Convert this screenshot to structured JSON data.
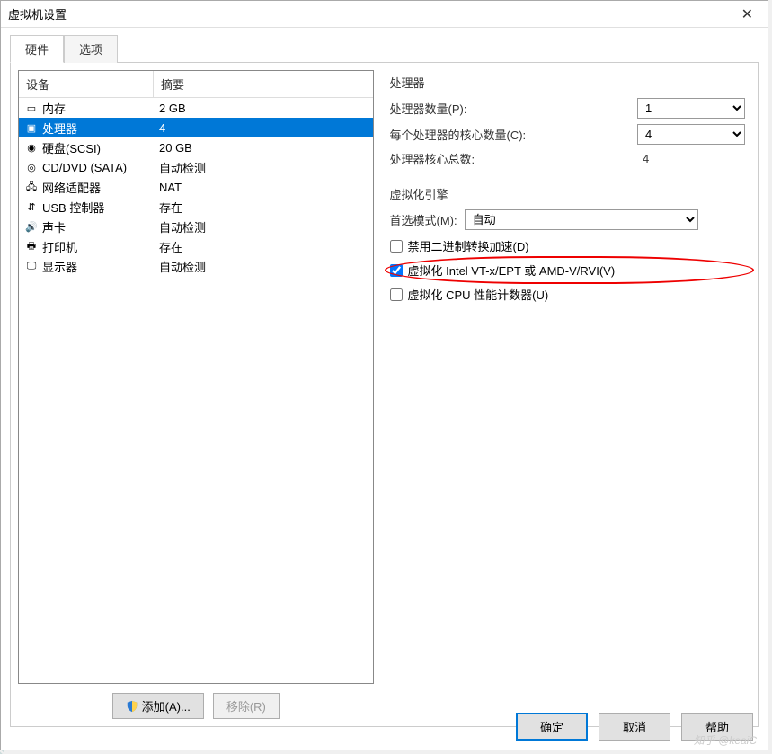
{
  "window": {
    "title": "虚拟机设置"
  },
  "tabs": {
    "hardware": "硬件",
    "options": "选项"
  },
  "hwlist": {
    "header_device": "设备",
    "header_summary": "摘要",
    "rows": [
      {
        "icon": "memory-icon",
        "name": "内存",
        "summary": "2 GB"
      },
      {
        "icon": "cpu-icon",
        "name": "处理器",
        "summary": "4"
      },
      {
        "icon": "disk-icon",
        "name": "硬盘(SCSI)",
        "summary": "20 GB"
      },
      {
        "icon": "cd-icon",
        "name": "CD/DVD (SATA)",
        "summary": "自动检测"
      },
      {
        "icon": "net-icon",
        "name": "网络适配器",
        "summary": "NAT"
      },
      {
        "icon": "usb-icon",
        "name": "USB 控制器",
        "summary": "存在"
      },
      {
        "icon": "sound-icon",
        "name": "声卡",
        "summary": "自动检测"
      },
      {
        "icon": "printer-icon",
        "name": "打印机",
        "summary": "存在"
      },
      {
        "icon": "display-icon",
        "name": "显示器",
        "summary": "自动检测"
      }
    ],
    "selected_index": 1
  },
  "processor": {
    "group_title": "处理器",
    "count_label": "处理器数量(P):",
    "count_value": "1",
    "cores_label": "每个处理器的核心数量(C):",
    "cores_value": "4",
    "total_label": "处理器核心总数:",
    "total_value": "4"
  },
  "virt": {
    "group_title": "虚拟化引擎",
    "mode_label": "首选模式(M):",
    "mode_value": "自动",
    "disable_binary_label": "禁用二进制转换加速(D)",
    "disable_binary_checked": false,
    "vt_label": "虚拟化 Intel VT-x/EPT 或 AMD-V/RVI(V)",
    "vt_checked": true,
    "perf_label": "虚拟化 CPU 性能计数器(U)",
    "perf_checked": false
  },
  "buttons": {
    "add": "添加(A)...",
    "remove": "移除(R)",
    "ok": "确定",
    "cancel": "取消",
    "help": "帮助"
  },
  "watermark": "知乎 @keaiC",
  "icon_glyphs": {
    "memory-icon": "▭",
    "cpu-icon": "▣",
    "disk-icon": "◉",
    "cd-icon": "◎",
    "net-icon": "🖧",
    "usb-icon": "⇵",
    "sound-icon": "🔊",
    "printer-icon": "🖶",
    "display-icon": "🖵"
  }
}
